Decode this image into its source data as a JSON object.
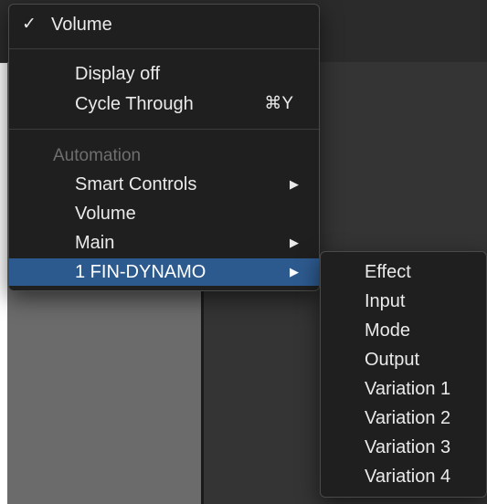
{
  "main_menu": {
    "checked_item": "Volume",
    "display_off": "Display off",
    "cycle_through": "Cycle Through",
    "cycle_shortcut": "⌘Y",
    "automation_header": "Automation",
    "smart_controls": "Smart Controls",
    "volume": "Volume",
    "main": "Main",
    "fin_dynamo": "1 FIN-DYNAMO",
    "check_glyph": "✓",
    "arrow_glyph": "▶"
  },
  "sub_menu": {
    "items": [
      "Effect",
      "Input",
      "Mode",
      "Output",
      "Variation 1",
      "Variation 2",
      "Variation 3",
      "Variation 4"
    ]
  },
  "colors": {
    "menu_bg": "#1f1f1f",
    "highlight": "#2d5a8e",
    "text": "#eaeaea",
    "header_text": "#6e6e6e"
  }
}
